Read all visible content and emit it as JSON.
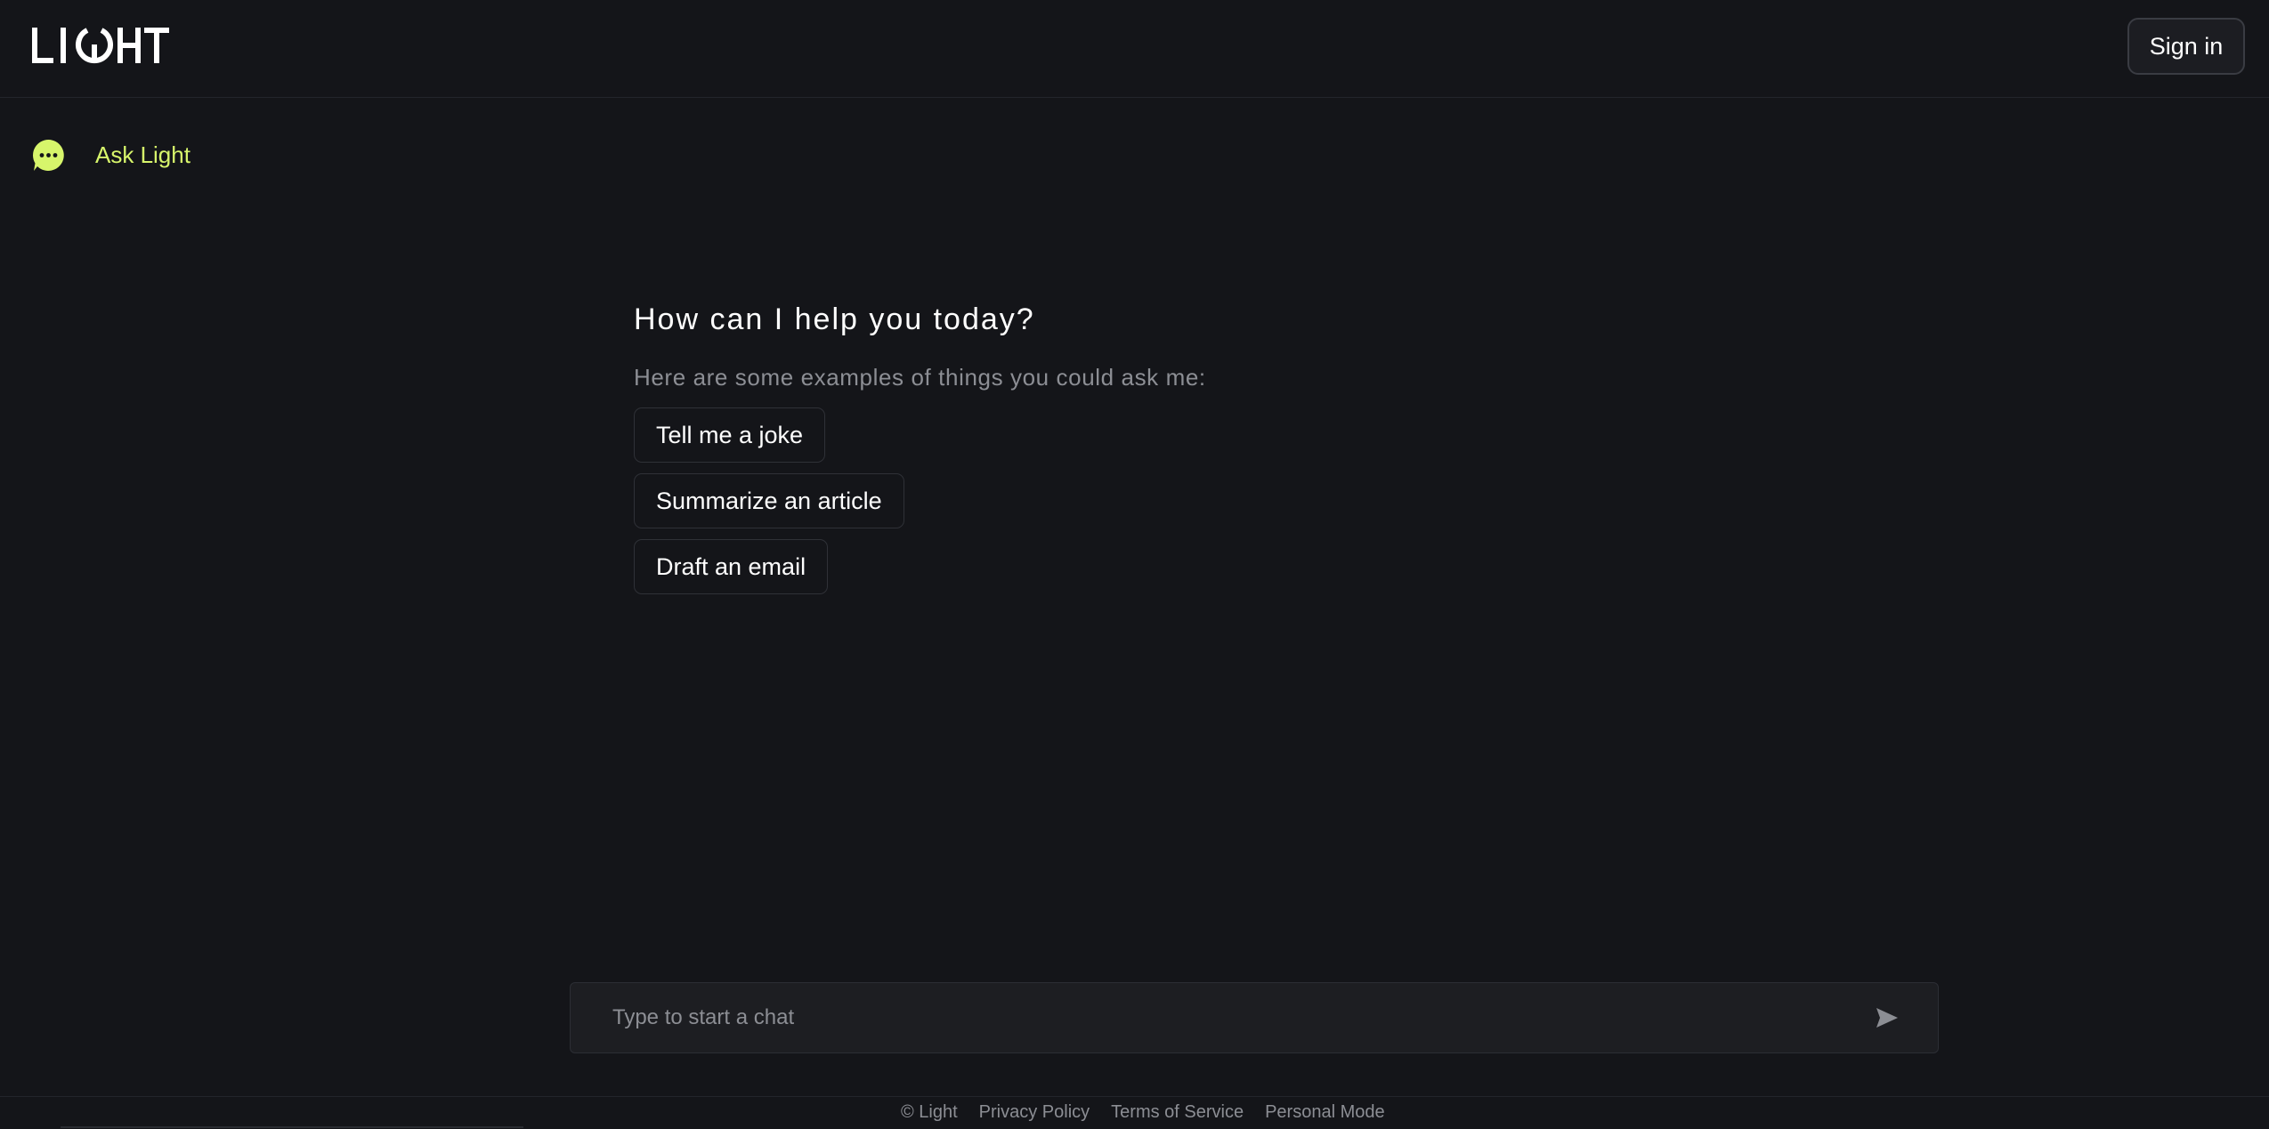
{
  "header": {
    "logo_text": "LIGHT",
    "signin_label": "Sign in"
  },
  "sidebar": {
    "items": [
      {
        "label": "Ask Light",
        "icon": "chat-bubble-icon"
      }
    ]
  },
  "main": {
    "title": "How can I help you today?",
    "subtitle": "Here are some examples of things you could ask me:",
    "suggestions": [
      {
        "label": "Tell me a joke"
      },
      {
        "label": "Summarize an article"
      },
      {
        "label": "Draft an email"
      }
    ]
  },
  "chat": {
    "placeholder": "Type to start a chat",
    "value": "",
    "send_icon": "send-icon"
  },
  "footer": {
    "copyright": "© Light",
    "links": [
      {
        "label": "Privacy Policy"
      },
      {
        "label": "Terms of Service"
      },
      {
        "label": "Personal Mode"
      }
    ]
  },
  "colors": {
    "background": "#141519",
    "accent": "#d7f56b",
    "muted_text": "#8c8e94",
    "border": "#2f3137"
  }
}
